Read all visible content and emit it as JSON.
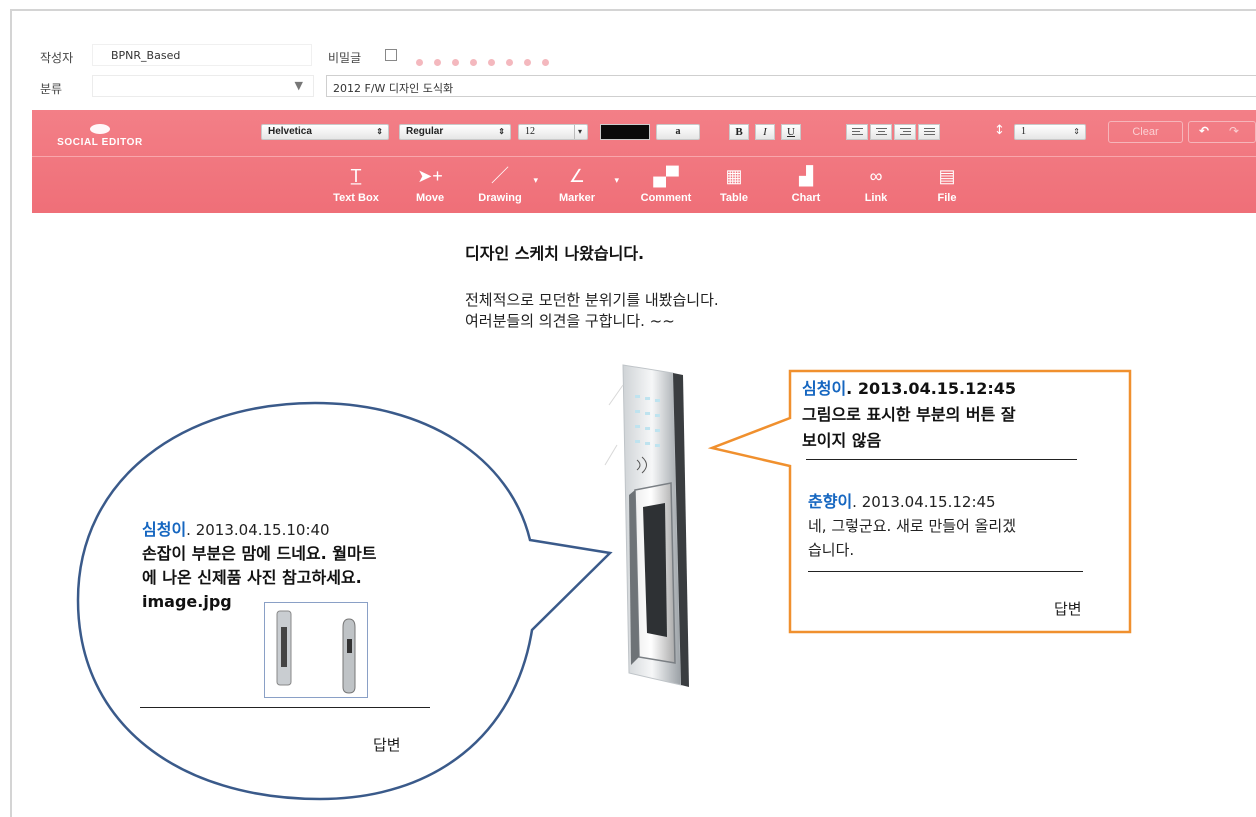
{
  "form": {
    "author_label": "작성자",
    "author_value": "BPNR_Based",
    "secret_label": "비밀글",
    "category_label": "분류",
    "title_value": "2012 F/W 디자인 도식화"
  },
  "toolbar": {
    "logo_text": "SOCIAL EDITOR",
    "font_family": "Helvetica",
    "font_style": "Regular",
    "font_size": "12",
    "text_color": "#0a0a0a",
    "highlight_label": "a",
    "bold_label": "B",
    "italic_label": "I",
    "underline_label": "U",
    "line_spacing": "1",
    "clear_label": "Clear",
    "tools": [
      {
        "label": "Text Box",
        "icon": "text-box-icon"
      },
      {
        "label": "Move",
        "icon": "move-icon"
      },
      {
        "label": "Drawing",
        "icon": "pencil-icon"
      },
      {
        "label": "Marker",
        "icon": "marker-icon"
      },
      {
        "label": "Comment",
        "icon": "comment-icon"
      },
      {
        "label": "Table",
        "icon": "table-icon"
      },
      {
        "label": "Chart",
        "icon": "chart-icon"
      },
      {
        "label": "Link",
        "icon": "link-icon"
      },
      {
        "label": "File",
        "icon": "file-icon"
      }
    ],
    "accent_color": "#f07880"
  },
  "document": {
    "title": "디자인 스케치 나왔습니다.",
    "body_line1": "전체적으로 모던한 분위기를 내봤습니다.",
    "body_line2": "여러분들의 의견을 구합니다. ~~"
  },
  "comments": {
    "left": {
      "author": "심청이",
      "timestamp": ". 2013.04.15.10:40",
      "line1": "손잡이 부분은 맘에 드네요. 월마트",
      "line2": "에 나온 신제품 사진 참고하세요.",
      "attachment": "image.jpg",
      "reply_label": "답변",
      "border_color": "#3a5a8a"
    },
    "right": {
      "author": "심청이",
      "timestamp": ". 2013.04.15.12:45",
      "line1": "그림으로 표시한 부분의 버튼 잘",
      "line2": "보이지 않음",
      "reply_author": "춘향이",
      "reply_timestamp": ". 2013.04.15.12:45",
      "reply_line1": "네, 그렇군요. 새로 만들어 올리겠",
      "reply_line2": "습니다.",
      "reply_label": "답변",
      "border_color": "#f0902e"
    }
  }
}
